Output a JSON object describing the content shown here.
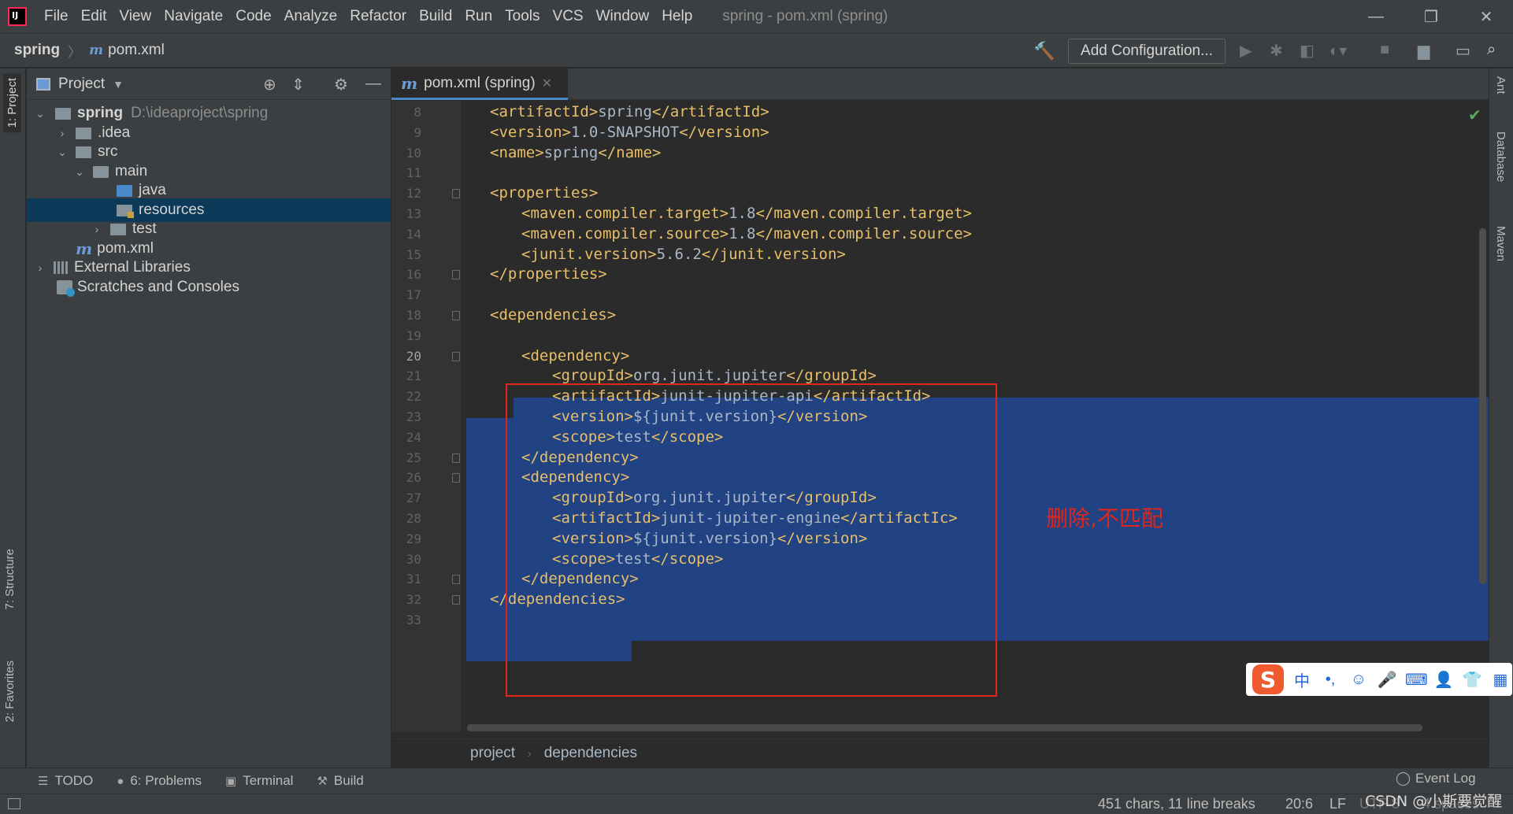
{
  "window": {
    "title": "spring - pom.xml (spring)",
    "minimize_icon": "—",
    "restore_icon": "❐",
    "close_icon": "✕"
  },
  "menu": [
    "File",
    "Edit",
    "View",
    "Navigate",
    "Code",
    "Analyze",
    "Refactor",
    "Build",
    "Run",
    "Tools",
    "VCS",
    "Window",
    "Help"
  ],
  "navbar": {
    "project": "spring",
    "file": "pom.xml",
    "add_configuration": "Add Configuration..."
  },
  "left_tabs": {
    "project": "1: Project",
    "structure": "7: Structure",
    "favorites": "2: Favorites"
  },
  "right_tabs": {
    "ant": "Ant",
    "database": "Database",
    "maven": "Maven"
  },
  "project_panel": {
    "title": "Project",
    "tree": {
      "root": "spring",
      "root_path": "D:\\ideaproject\\spring",
      "idea": ".idea",
      "src": "src",
      "main": "main",
      "java": "java",
      "resources": "resources",
      "test": "test",
      "pom": "pom.xml",
      "libs": "External Libraries",
      "scratches": "Scratches and Consoles"
    }
  },
  "editor": {
    "tab_label": "pom.xml (spring)",
    "current_line": 20,
    "line_numbers": [
      "8",
      "9",
      "10",
      "11",
      "12",
      "13",
      "14",
      "15",
      "16",
      "17",
      "18",
      "19",
      "20",
      "21",
      "22",
      "23",
      "24",
      "25",
      "26",
      "27",
      "28",
      "29",
      "30",
      "31",
      "32",
      "33"
    ],
    "lines": {
      "l8_open": "<artifactId>",
      "l8_val": "spring",
      "l8_close": "</artifactId>",
      "l9_open": "<version>",
      "l9_val": "1.0-SNAPSHOT",
      "l9_close": "</version>",
      "l10_open": "<name>",
      "l10_val": "spring",
      "l10_close": "</name>",
      "l12": "<properties>",
      "l13_open": "<maven.compiler.target>",
      "l13_val": "1.8",
      "l13_close": "</maven.compiler.target>",
      "l14_open": "<maven.compiler.source>",
      "l14_val": "1.8",
      "l14_close": "</maven.compiler.source>",
      "l15_open": "<junit.version>",
      "l15_val": "5.6.2",
      "l15_close": "</junit.version>",
      "l16": "</properties>",
      "l18": "<dependencies>",
      "l20": "<dependency>",
      "l21_open": "<groupId>",
      "l21_val": "org.junit.jupiter",
      "l21_close": "</groupId>",
      "l22_open": "<artifactId>",
      "l22_val": "junit-jupiter-api",
      "l22_close": "</artifactId>",
      "l23_open": "<version>",
      "l23_val": "${junit.version}",
      "l23_close": "</version>",
      "l24_open": "<scope>",
      "l24_val": "test",
      "l24_close": "</scope>",
      "l25": "</dependency>",
      "l26": "<dependency>",
      "l27_open": "<groupId>",
      "l27_val": "org.junit.jupiter",
      "l27_close": "</groupId>",
      "l28_open": "<artifactId>",
      "l28_val": "junit-jupiter-engine",
      "l28_close": "</artifactIc>",
      "l29_open": "<version>",
      "l29_val": "${junit.version}",
      "l29_close": "</version>",
      "l30_open": "<scope>",
      "l30_val": "test",
      "l30_close": "</scope>",
      "l31": "</dependency>",
      "l32": "</dependencies>"
    },
    "annotation": "删除,不匹配",
    "breadcrumbs": [
      "project",
      "dependencies"
    ]
  },
  "ime": {
    "logo": "S",
    "buttons": [
      "中",
      "•,",
      "☺",
      "🎤",
      "⌨",
      "👤",
      "👕",
      "▦"
    ]
  },
  "bottom_tools": {
    "todo": "TODO",
    "problems": "6: Problems",
    "terminal": "Terminal",
    "build": "Build",
    "event_log": "Event Log"
  },
  "status": {
    "chars": "451 chars, 11 line breaks",
    "position": "20:6",
    "line_sep": "LF",
    "encoding": "UTF-8",
    "spaces": "4 spaces",
    "watermark": "CSDN @小斯要觉醒"
  },
  "colors": {
    "tag": "#e8bf6a",
    "text": "#a9b7c6",
    "selection": "#214283",
    "annotation_red": "#e0251b"
  }
}
